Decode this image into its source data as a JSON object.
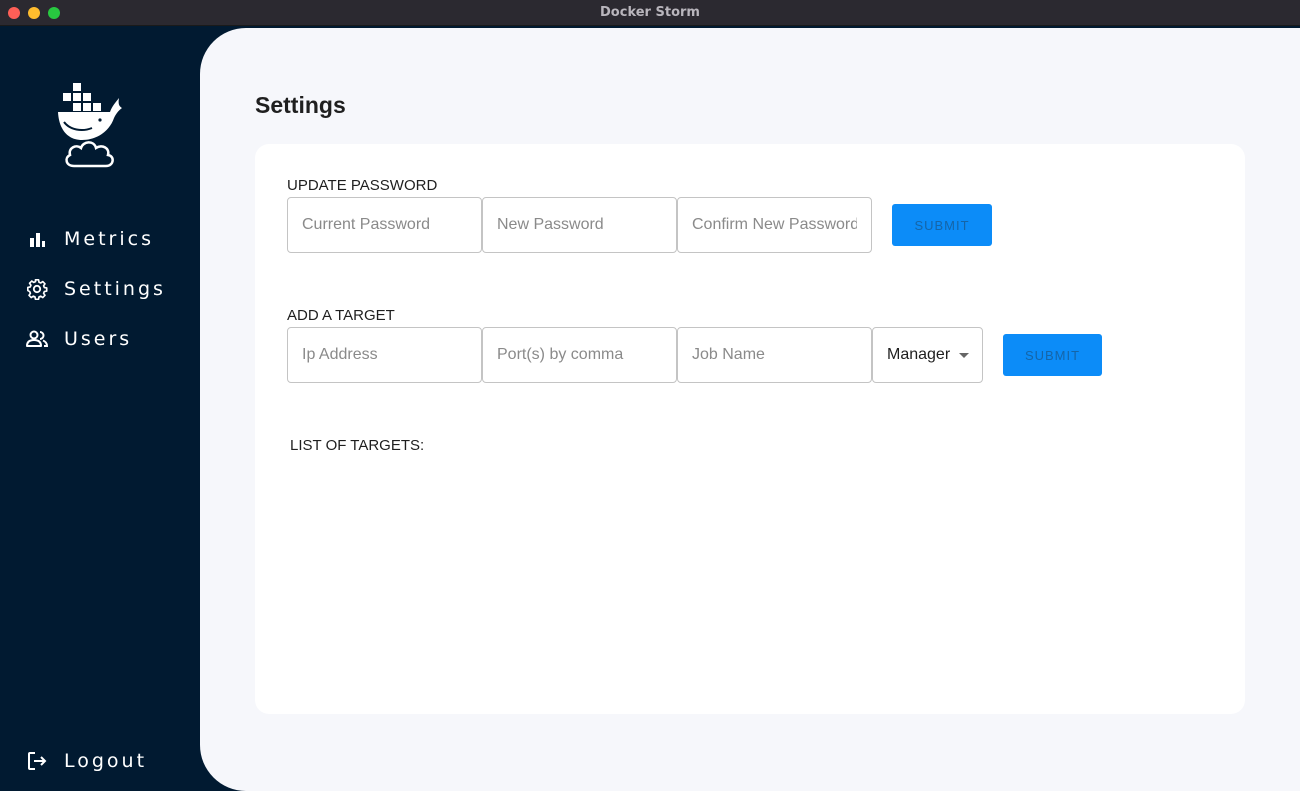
{
  "window": {
    "title": "Docker Storm"
  },
  "sidebar": {
    "items": [
      {
        "label": "Metrics",
        "icon": "bar-chart-icon"
      },
      {
        "label": "Settings",
        "icon": "gear-icon"
      },
      {
        "label": "Users",
        "icon": "users-icon"
      }
    ],
    "logout": {
      "label": "Logout",
      "icon": "logout-icon"
    }
  },
  "main": {
    "title": "Settings",
    "update_password": {
      "heading": "UPDATE PASSWORD",
      "current_placeholder": "Current Password",
      "new_placeholder": "New Password",
      "confirm_placeholder": "Confirm New Password",
      "submit_label": "SUBMIT"
    },
    "add_target": {
      "heading": "ADD A TARGET",
      "ip_placeholder": "Ip Address",
      "ports_placeholder": "Port(s) by comma",
      "job_placeholder": "Job Name",
      "role_selected": "Manager",
      "submit_label": "SUBMIT"
    },
    "targets": {
      "heading": "LIST OF TARGETS:"
    }
  },
  "colors": {
    "sidebar_bg": "#011a31",
    "main_bg": "#f6f7fb",
    "accent": "#0c8cf8"
  }
}
